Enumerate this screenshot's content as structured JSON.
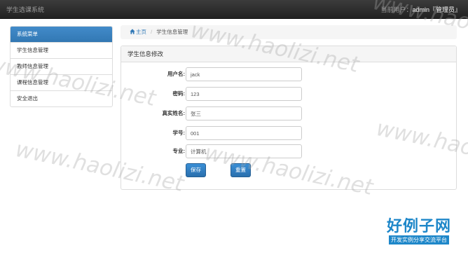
{
  "header": {
    "brand": "学生选课系统",
    "user_prefix": "当前用户：",
    "user_name": "admin『管理员』"
  },
  "sidebar": {
    "title": "系统菜单",
    "items": [
      {
        "label": "学生信息管理"
      },
      {
        "label": "教师信息管理"
      },
      {
        "label": "课程信息管理"
      },
      {
        "label": "安全退出"
      }
    ]
  },
  "breadcrumb": {
    "home_icon": "home-icon",
    "home": "主页",
    "separator": "/",
    "current": "学生信息管理"
  },
  "panel": {
    "title": "学生信息修改"
  },
  "form": {
    "fields": [
      {
        "label": "用户名:",
        "value": "jack"
      },
      {
        "label": "密码:",
        "value": "123"
      },
      {
        "label": "真实姓名:",
        "value": "张三"
      },
      {
        "label": "学号:",
        "value": "001"
      },
      {
        "label": "专业:",
        "value": "计算机"
      }
    ],
    "save_label": "保存",
    "reset_label": "重置"
  },
  "branding": {
    "logo_text": "好例子网",
    "logo_tagline": "开发实例分享交流平台"
  },
  "watermark_text": "www.haolizi.net",
  "colors": {
    "navbar": "#222222",
    "primary": "#428bca",
    "logo_blue": "#1e87c9"
  }
}
